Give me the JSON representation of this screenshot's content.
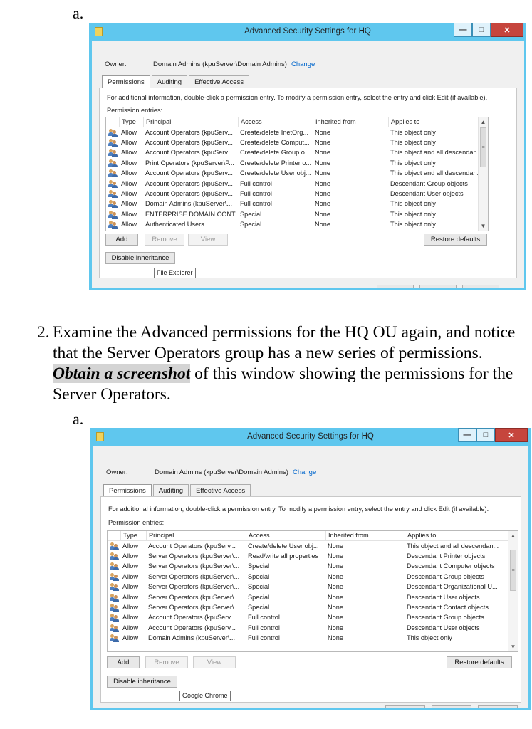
{
  "doc": {
    "label_a": "a.",
    "step_number": "2.",
    "step_text_before": "Examine the Advanced permissions for the HQ OU again, and notice that the Server Operators group has a new series of permissions. ",
    "step_highlight": "Obtain a screenshot",
    "step_text_after": " of this window showing the permissions for the Server Operators."
  },
  "colors": {
    "titlebar": "#5fc7ee",
    "link": "#0066cc",
    "close_button": "#c6453d"
  },
  "window1": {
    "title": "Advanced Security Settings for HQ",
    "owner_label": "Owner:",
    "owner_value": "Domain Admins (kpuServer\\Domain Admins)",
    "owner_change": "Change",
    "tabs": [
      "Permissions",
      "Auditing",
      "Effective Access"
    ],
    "info": "For additional information, double-click a permission entry. To modify a permission entry, select the entry and click Edit (if available).",
    "entries_label": "Permission entries:",
    "columns": [
      "Type",
      "Principal",
      "Access",
      "Inherited from",
      "Applies to"
    ],
    "rows": [
      [
        "Allow",
        "Account Operators (kpuServ...",
        "Create/delete InetOrg...",
        "None",
        "This object only"
      ],
      [
        "Allow",
        "Account Operators (kpuServ...",
        "Create/delete Comput...",
        "None",
        "This object only"
      ],
      [
        "Allow",
        "Account Operators (kpuServ...",
        "Create/delete Group o...",
        "None",
        "This object and all descendan..."
      ],
      [
        "Allow",
        "Print Operators (kpuServer\\P...",
        "Create/delete Printer o...",
        "None",
        "This object only"
      ],
      [
        "Allow",
        "Account Operators (kpuServ...",
        "Create/delete User obj...",
        "None",
        "This object and all descendan..."
      ],
      [
        "Allow",
        "Account Operators (kpuServ...",
        "Full control",
        "None",
        "Descendant Group objects"
      ],
      [
        "Allow",
        "Account Operators (kpuServ...",
        "Full control",
        "None",
        "Descendant User objects"
      ],
      [
        "Allow",
        "Domain Admins (kpuServer\\...",
        "Full control",
        "None",
        "This object only"
      ],
      [
        "Allow",
        "ENTERPRISE DOMAIN CONT...",
        "Special",
        "None",
        "This object only"
      ],
      [
        "Allow",
        "Authenticated Users",
        "Special",
        "None",
        "This object only"
      ]
    ],
    "buttons": {
      "add": "Add",
      "remove": "Remove",
      "view": "View",
      "restore": "Restore defaults",
      "disable_inheritance": "Disable inheritance"
    },
    "tooltip": "File Explorer",
    "icons": {
      "window": "folder-icon",
      "principal": "users-icon",
      "minimize": "minimize-icon",
      "maximize": "maximize-icon",
      "close": "close-icon"
    }
  },
  "window2": {
    "title": "Advanced Security Settings for HQ",
    "owner_label": "Owner:",
    "owner_value": "Domain Admins (kpuServer\\Domain Admins)",
    "owner_change": "Change",
    "tabs": [
      "Permissions",
      "Auditing",
      "Effective Access"
    ],
    "info": "For additional information, double-click a permission entry. To modify a permission entry, select the entry and click Edit (if available).",
    "entries_label": "Permission entries:",
    "columns": [
      "Type",
      "Principal",
      "Access",
      "Inherited from",
      "Applies to"
    ],
    "rows": [
      [
        "Allow",
        "Account Operators (kpuServ...",
        "Create/delete User obj...",
        "None",
        "This object and all descendan..."
      ],
      [
        "Allow",
        "Server Operators (kpuServer\\...",
        "Read/write all properties",
        "None",
        "Descendant Printer objects"
      ],
      [
        "Allow",
        "Server Operators (kpuServer\\...",
        "Special",
        "None",
        "Descendant Computer objects"
      ],
      [
        "Allow",
        "Server Operators (kpuServer\\...",
        "Special",
        "None",
        "Descendant Group objects"
      ],
      [
        "Allow",
        "Server Operators (kpuServer\\...",
        "Special",
        "None",
        "Descendant Organizational U..."
      ],
      [
        "Allow",
        "Server Operators (kpuServer\\...",
        "Special",
        "None",
        "Descendant User objects"
      ],
      [
        "Allow",
        "Server Operators (kpuServer\\...",
        "Special",
        "None",
        "Descendant Contact objects"
      ],
      [
        "Allow",
        "Account Operators (kpuServ...",
        "Full control",
        "None",
        "Descendant Group objects"
      ],
      [
        "Allow",
        "Account Operators (kpuServ...",
        "Full control",
        "None",
        "Descendant User objects"
      ],
      [
        "Allow",
        "Domain Admins (kpuServer\\...",
        "Full control",
        "None",
        "This object only"
      ]
    ],
    "buttons": {
      "add": "Add",
      "remove": "Remove",
      "view": "View",
      "restore": "Restore defaults",
      "disable_inheritance": "Disable inheritance"
    },
    "tooltip": "Google Chrome",
    "icons": {
      "window": "folder-icon",
      "principal": "users-icon",
      "minimize": "minimize-icon",
      "maximize": "maximize-icon",
      "close": "close-icon"
    }
  }
}
